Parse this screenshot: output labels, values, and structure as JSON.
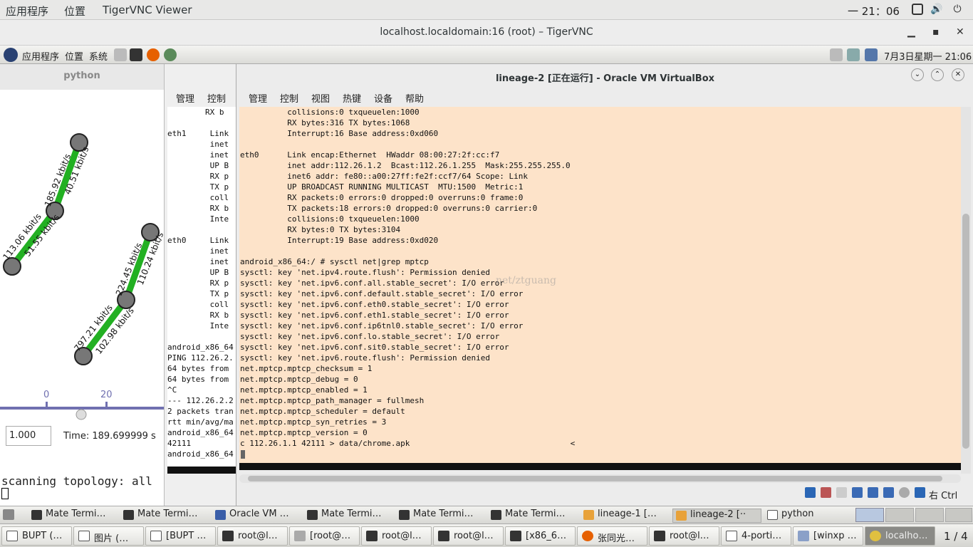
{
  "outer_bar": {
    "apps": "应用程序",
    "places": "位置",
    "app_name": "TigerVNC Viewer",
    "clock": "一 21：06"
  },
  "vnc": {
    "title": "localhost.localdomain:16 (root) – TigerVNC"
  },
  "remote_panel": {
    "apps": "应用程序",
    "places": "位置",
    "system": "系统",
    "datetime": "7月3日星期一 21:06"
  },
  "python_win": {
    "title": "python",
    "labels": [
      "113.06 kbit/s",
      "185.92 kbit/s",
      "40.51 kbit/s",
      "51.55 kbit/s",
      "797.21 kbit/s",
      "224.45 kbit/s",
      "110.24 kbit/s",
      "102.98 kbit/s"
    ],
    "axis_ticks": [
      "0",
      "20"
    ],
    "speed": "1.000",
    "time": "Time: 189.699999 s",
    "console": "scanning topology: all"
  },
  "mid_win": {
    "menu": [
      "管理",
      "控制"
    ],
    "lines": [
      "        RX b",
      "",
      "eth1     Link",
      "         inet",
      "         inet",
      "         UP B",
      "         RX p",
      "         TX p",
      "         coll",
      "         RX b",
      "         Inte",
      "",
      "eth0     Link",
      "         inet",
      "         inet",
      "         UP B",
      "         RX p",
      "         TX p",
      "         coll",
      "         RX b",
      "         Inte",
      "",
      "android_x86_64",
      "PING 112.26.2.",
      "64 bytes from",
      "64 bytes from",
      "^C",
      "--- 112.26.2.2",
      "2 packets tran",
      "rtt min/avg/ma",
      "android_x86_64",
      "42111",
      "android_x86_64"
    ]
  },
  "vbox": {
    "title": "lineage-2 [正在运行] - Oracle VM VirtualBox",
    "menu": [
      "管理",
      "控制",
      "视图",
      "热键",
      "设备",
      "帮助"
    ],
    "terminal": [
      "          collisions:0 txqueuelen:1000",
      "          RX bytes:316 TX bytes:1068",
      "          Interrupt:16 Base address:0xd060",
      "",
      "eth0      Link encap:Ethernet  HWaddr 08:00:27:2f:cc:f7",
      "          inet addr:112.26.1.2  Bcast:112.26.1.255  Mask:255.255.255.0",
      "          inet6 addr: fe80::a00:27ff:fe2f:ccf7/64 Scope: Link",
      "          UP BROADCAST RUNNING MULTICAST  MTU:1500  Metric:1",
      "          RX packets:0 errors:0 dropped:0 overruns:0 frame:0",
      "          TX packets:18 errors:0 dropped:0 overruns:0 carrier:0",
      "          collisions:0 txqueuelen:1000",
      "          RX bytes:0 TX bytes:3104",
      "          Interrupt:19 Base address:0xd020",
      "",
      "android_x86_64:/ # sysctl net|grep mptcp",
      "sysctl: key 'net.ipv4.route.flush': Permission denied",
      "sysctl: key 'net.ipv6.conf.all.stable_secret': I/O error",
      "sysctl: key 'net.ipv6.conf.default.stable_secret': I/O error",
      "sysctl: key 'net.ipv6.conf.eth0.stable_secret': I/O error",
      "sysctl: key 'net.ipv6.conf.eth1.stable_secret': I/O error",
      "sysctl: key 'net.ipv6.conf.ip6tnl0.stable_secret': I/O error",
      "sysctl: key 'net.ipv6.conf.lo.stable_secret': I/O error",
      "sysctl: key 'net.ipv6.conf.sit0.stable_secret': I/O error",
      "sysctl: key 'net.ipv6.route.flush': Permission denied",
      "net.mptcp.mptcp_checksum = 1",
      "net.mptcp.mptcp_debug = 0",
      "net.mptcp.mptcp_enabled = 1",
      "net.mptcp.mptcp_path_manager = fullmesh",
      "net.mptcp.mptcp_scheduler = default",
      "net.mptcp.mptcp_syn_retries = 3",
      "net.mptcp.mptcp_version = 0",
      "c 112.26.1.1 42111 > data/chrome.apk                                  <"
    ],
    "watermark": "net/ztguang",
    "host_key": "右 Ctrl"
  },
  "taskbar1": [
    "Mate Termi…",
    "Mate Termi…",
    "Oracle VM …",
    "Mate Termi…",
    "Mate Termi…",
    "Mate Termi…",
    "lineage-1 […",
    "lineage-2 [··",
    "python"
  ],
  "taskbar2": [
    "BUPT (…",
    "图片 (…",
    "[BUPT …",
    "root@l…",
    "[root@…",
    "root@l…",
    "root@l…",
    "[x86_6…",
    "张同光…",
    "root@l…",
    "4-porti…",
    "[winxp …",
    "localho…"
  ],
  "workspace": "1 / 4"
}
